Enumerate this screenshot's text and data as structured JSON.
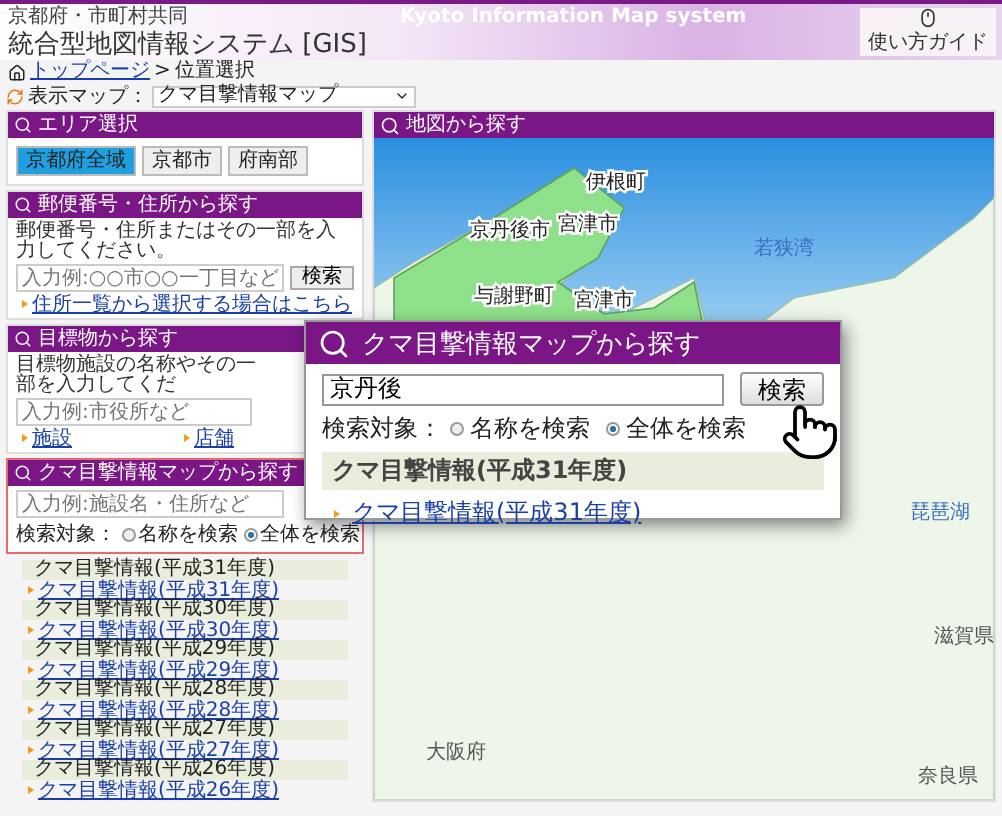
{
  "header": {
    "org": "京都府・市町村共同",
    "title": "統合型地図情報システム [GIS]",
    "banner": "Kyoto Information Map system",
    "guide_button": "使い方ガイド"
  },
  "breadcrumb": {
    "link": "トップページ",
    "separator": ">",
    "current": "位置選択"
  },
  "map_selector": {
    "label": "表示マップ：",
    "value": "クマ目撃情報マップ"
  },
  "area_panel": {
    "title": "エリア選択",
    "buttons": [
      {
        "label": "京都府全域",
        "selected": true
      },
      {
        "label": "京都市",
        "selected": false
      },
      {
        "label": "府南部",
        "selected": false
      }
    ]
  },
  "address_panel": {
    "title": "郵便番号・住所から探す",
    "instruction": "郵便番号・住所またはその一部を入力してください。",
    "placeholder": "入力例:○○市○○一丁目など",
    "button": "検索",
    "link": "住所一覧から選択する場合はこちら"
  },
  "landmark_panel": {
    "title": "目標物から探す",
    "instruction": "目標物施設の名称やその一部を入力してくだ",
    "placeholder": "入力例:市役所など",
    "links": [
      "施設",
      "店舗"
    ]
  },
  "bear_panel": {
    "title": "クマ目撃情報マップから探す",
    "placeholder": "入力例:施設名・住所など",
    "scope_label": "検索対象：",
    "options": [
      {
        "label": "名称を検索",
        "selected": false
      },
      {
        "label": "全体を検索",
        "selected": true
      }
    ]
  },
  "bear_list": [
    {
      "heading": "クマ目撃情報(平成31年度)",
      "link": "クマ目撃情報(平成31年度)"
    },
    {
      "heading": "クマ目撃情報(平成30年度)",
      "link": "クマ目撃情報(平成30年度)"
    },
    {
      "heading": "クマ目撃情報(平成29年度)",
      "link": "クマ目撃情報(平成29年度)"
    },
    {
      "heading": "クマ目撃情報(平成28年度)",
      "link": "クマ目撃情報(平成28年度)"
    },
    {
      "heading": "クマ目撃情報(平成27年度)",
      "link": "クマ目撃情報(平成27年度)"
    },
    {
      "heading": "クマ目撃情報(平成26年度)",
      "link": "クマ目撃情報(平成26年度)"
    }
  ],
  "map_panel": {
    "title": "地図から探す",
    "labels": [
      {
        "text": "伊根町",
        "kind": "town"
      },
      {
        "text": "京丹後市",
        "kind": "town"
      },
      {
        "text": "宮津市",
        "kind": "town"
      },
      {
        "text": "若狭湾",
        "kind": "sea"
      },
      {
        "text": "与謝野町",
        "kind": "town"
      },
      {
        "text": "宮津市",
        "kind": "town"
      },
      {
        "text": "琵琶湖",
        "kind": "sea"
      },
      {
        "text": "滋賀県",
        "kind": "region"
      },
      {
        "text": "大阪府",
        "kind": "region"
      },
      {
        "text": "奈良県",
        "kind": "region"
      }
    ]
  },
  "popup": {
    "title": "クマ目撃情報マップから探す",
    "value": "京丹後",
    "button": "検索",
    "scope_label": "検索対象：",
    "options": [
      {
        "label": "名称を検索",
        "selected": false
      },
      {
        "label": "全体を検索",
        "selected": true
      }
    ],
    "result_heading": "クマ目撃情報(平成31年度)",
    "result_link": "クマ目撃情報(平成31年度)"
  }
}
